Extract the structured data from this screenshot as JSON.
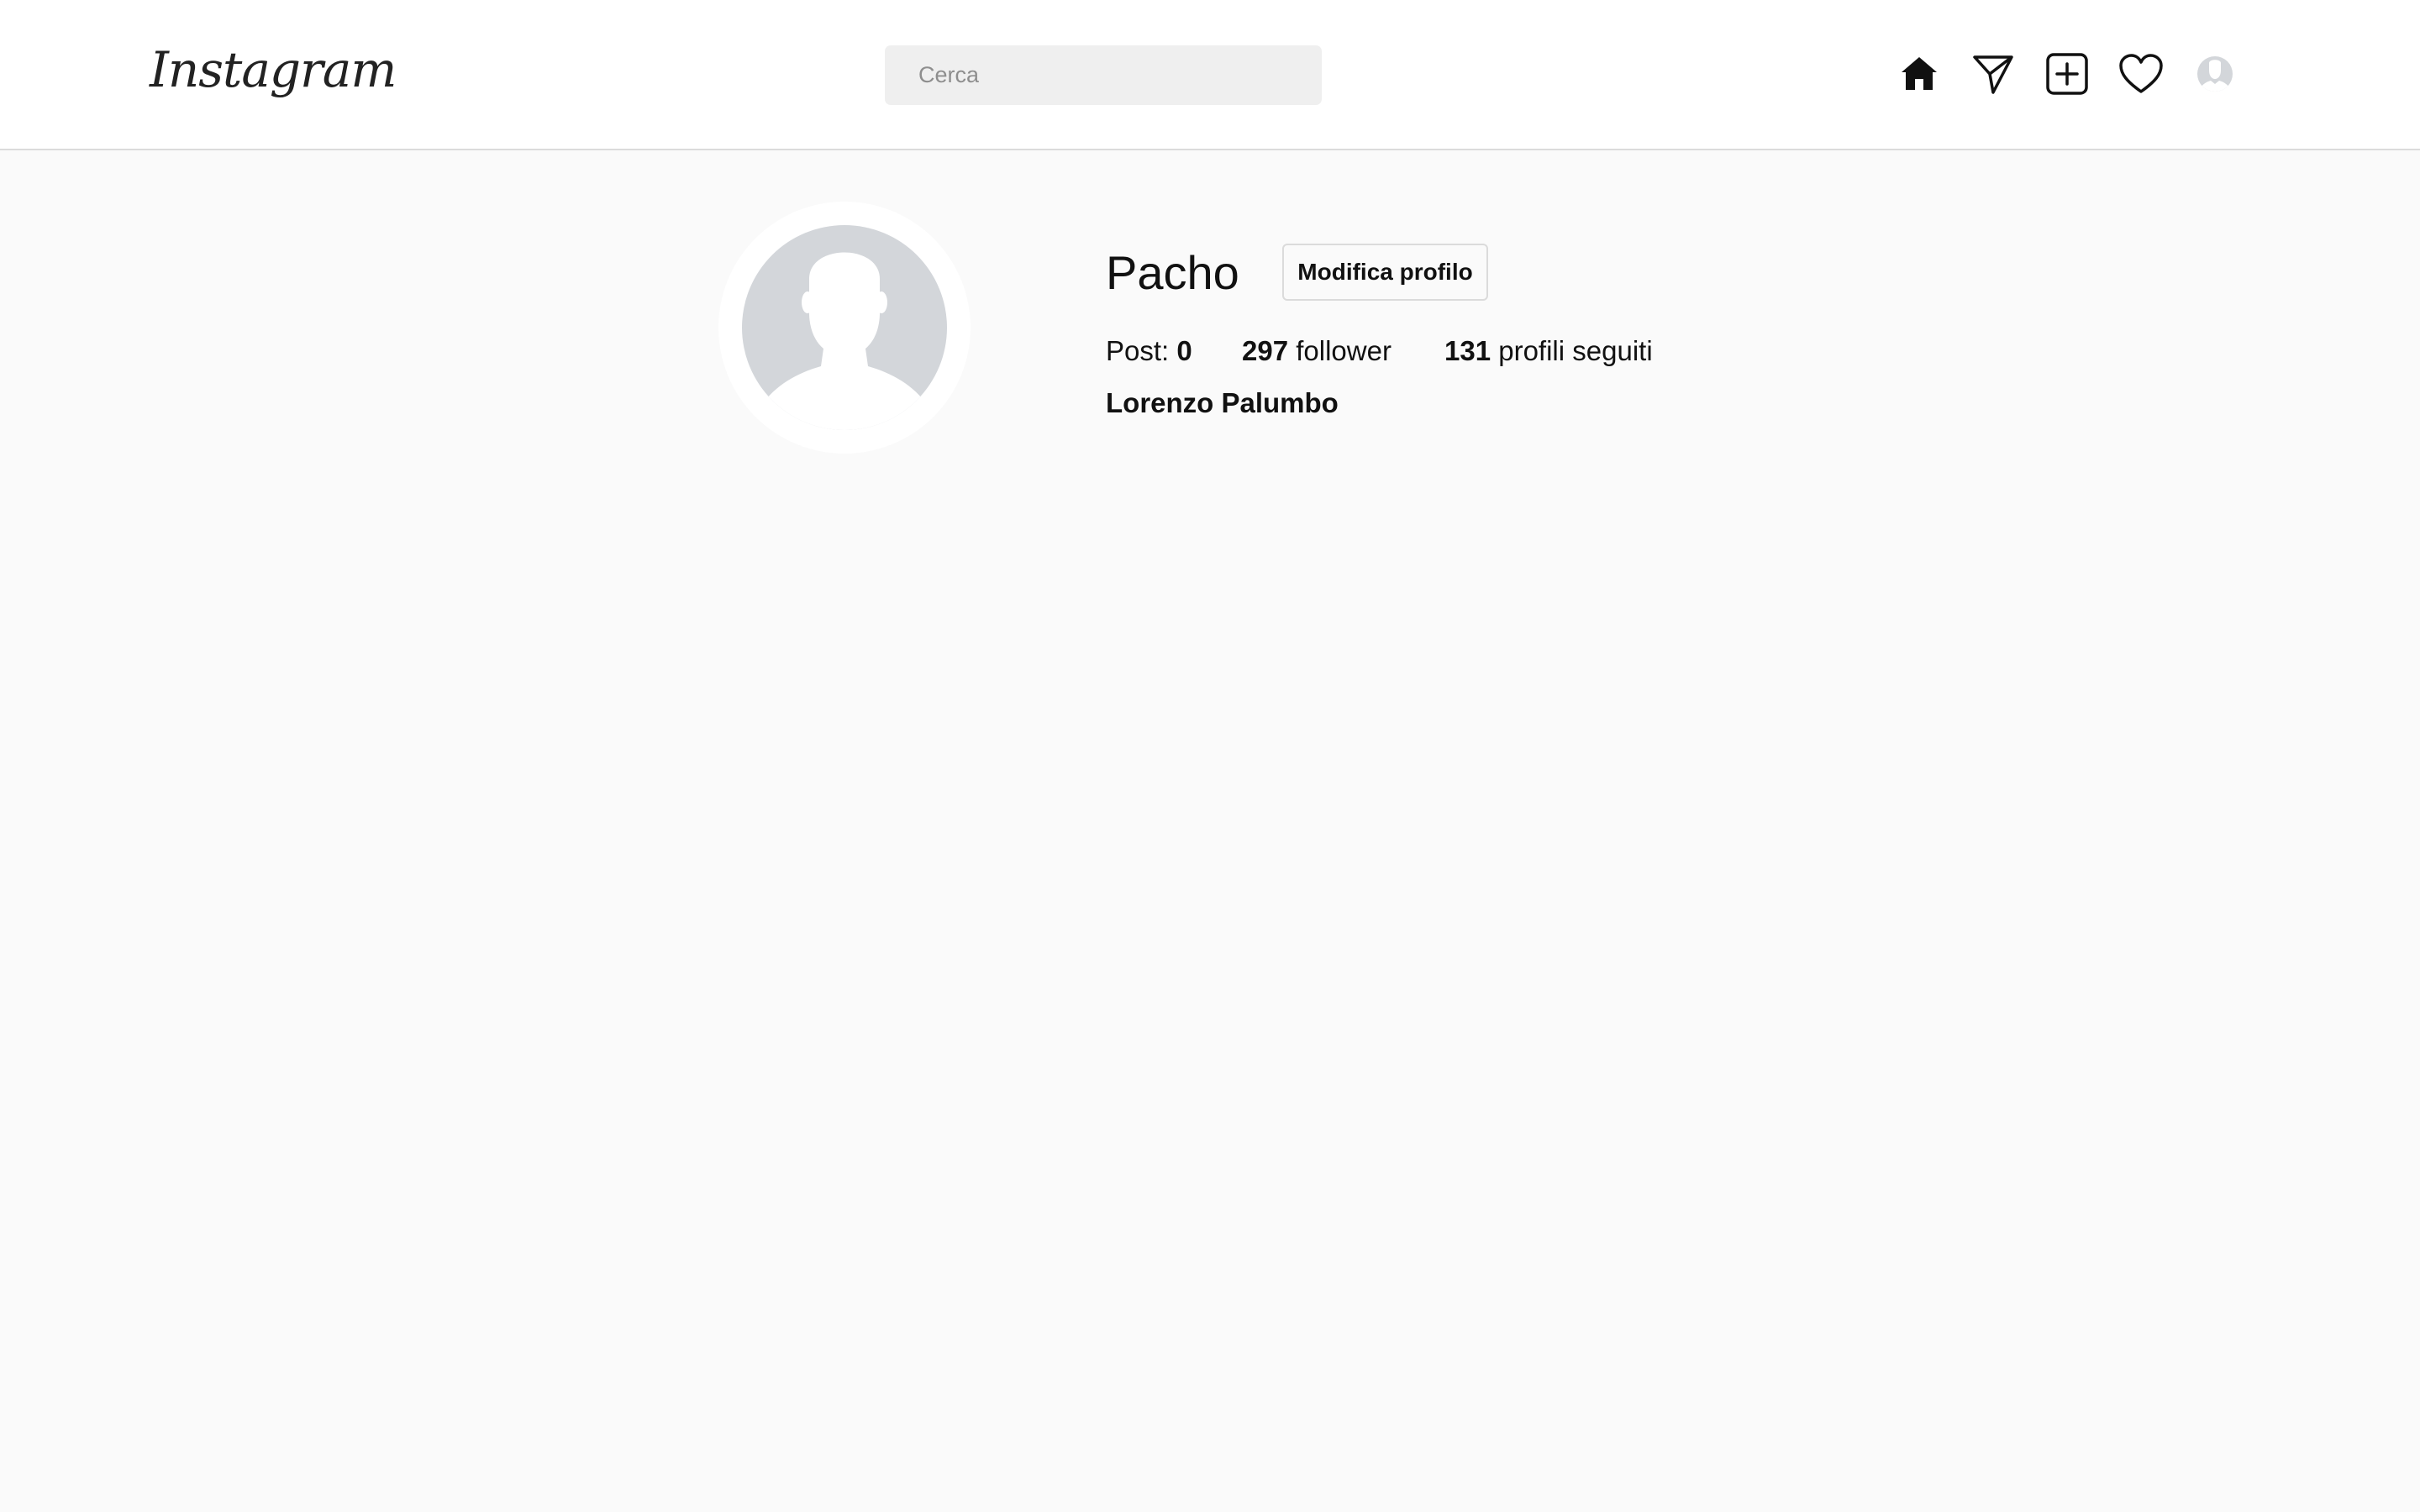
{
  "header": {
    "logo_text": "Instagram",
    "search": {
      "placeholder": "Cerca",
      "value": ""
    },
    "icons": [
      "home-icon",
      "direct-message-icon",
      "new-post-icon",
      "activity-heart-icon",
      "profile-avatar-icon"
    ]
  },
  "profile": {
    "username": "Pacho",
    "edit_button_label": "Modifica profilo",
    "stats": {
      "posts_label": "Post:",
      "posts_count": "0",
      "followers_count": "297",
      "followers_label": "follower",
      "following_count": "131",
      "following_label": "profili seguiti"
    },
    "full_name": "Lorenzo Palumbo"
  },
  "colors": {
    "page_background": "#fafafa",
    "header_background": "#ffffff",
    "search_background": "#efefef",
    "avatar_placeholder": "#d3d6da",
    "border": "#dbdbdb"
  }
}
